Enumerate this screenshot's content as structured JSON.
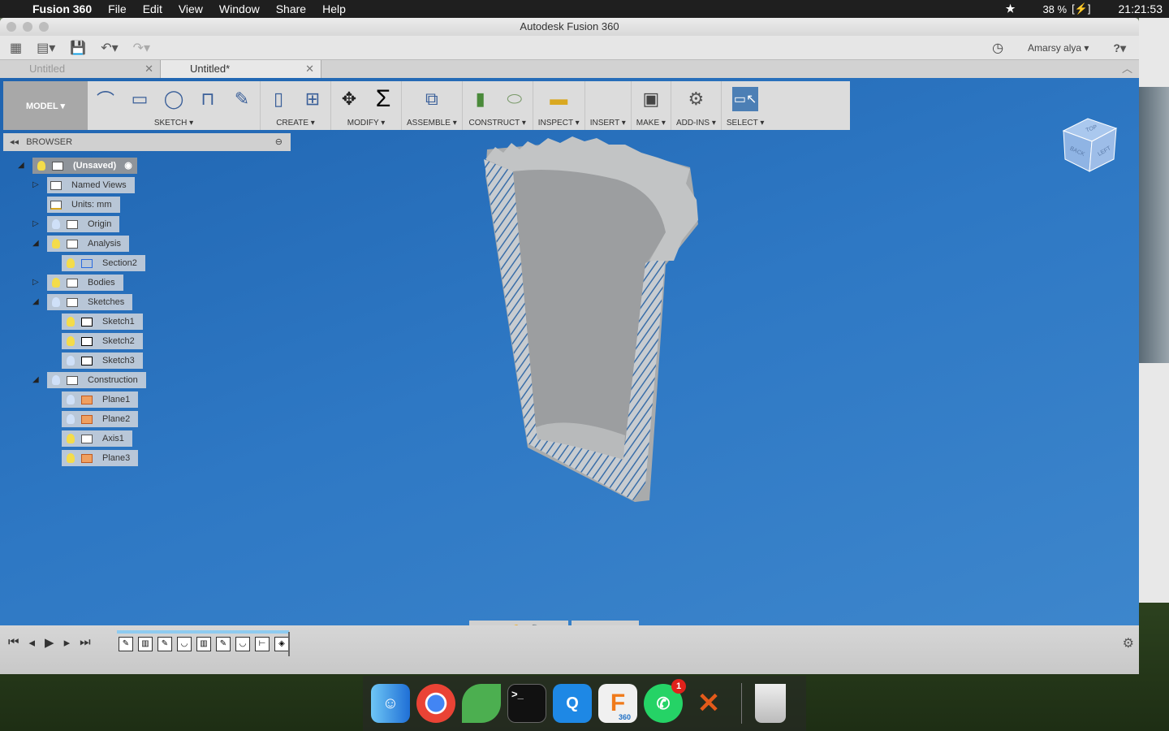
{
  "menubar": {
    "app": "Fusion 360",
    "items": [
      "File",
      "Edit",
      "View",
      "Window",
      "Share",
      "Help"
    ],
    "battery": "38 %",
    "time": "21:21:53"
  },
  "window": {
    "title": "Autodesk Fusion 360"
  },
  "qat": {
    "user": "Amarsy alya ▾",
    "help": "?▾"
  },
  "tabs": [
    {
      "label": "Untitled"
    },
    {
      "label": "Untitled*"
    }
  ],
  "toolbar": {
    "model": "MODEL ▾",
    "groups": [
      {
        "label": "SKETCH ▾",
        "icons": [
          "line-icon",
          "rectangle-icon",
          "circle-icon",
          "offset-icon",
          "create-sketch-icon"
        ]
      },
      {
        "label": "CREATE ▾",
        "icons": [
          "extrude-icon",
          "pattern-icon"
        ]
      },
      {
        "label": "MODIFY ▾",
        "icons": [
          "move-icon",
          "sigma-icon"
        ]
      },
      {
        "label": "ASSEMBLE ▾",
        "icons": [
          "new-component-icon"
        ]
      },
      {
        "label": "CONSTRUCT ▾",
        "icons": [
          "offset-plane-icon",
          "tangent-plane-icon"
        ]
      },
      {
        "label": "INSPECT ▾",
        "icons": [
          "measure-icon"
        ]
      },
      {
        "label": "INSERT ▾",
        "icons": []
      },
      {
        "label": "MAKE ▾",
        "icons": [
          "3d-print-icon"
        ]
      },
      {
        "label": "ADD-INS ▾",
        "icons": [
          "scripts-icon"
        ]
      },
      {
        "label": "SELECT ▾",
        "icons": [
          "select-icon"
        ]
      }
    ]
  },
  "browser": {
    "title": "BROWSER",
    "nodes": [
      {
        "label": "(Unsaved)"
      },
      {
        "label": "Named Views"
      },
      {
        "label": "Units: mm"
      },
      {
        "label": "Origin"
      },
      {
        "label": "Analysis"
      },
      {
        "label": "Section2"
      },
      {
        "label": "Bodies"
      },
      {
        "label": "Sketches"
      },
      {
        "label": "Sketch1"
      },
      {
        "label": "Sketch2"
      },
      {
        "label": "Sketch3"
      },
      {
        "label": "Construction"
      },
      {
        "label": "Plane1"
      },
      {
        "label": "Plane2"
      },
      {
        "label": "Axis1"
      },
      {
        "label": "Plane3"
      }
    ]
  },
  "viewcube": {
    "top": "TOP",
    "back": "BACK",
    "left": "LEFT"
  },
  "dock": {
    "whatsapp_badge": "1",
    "fusion_label": "360"
  }
}
